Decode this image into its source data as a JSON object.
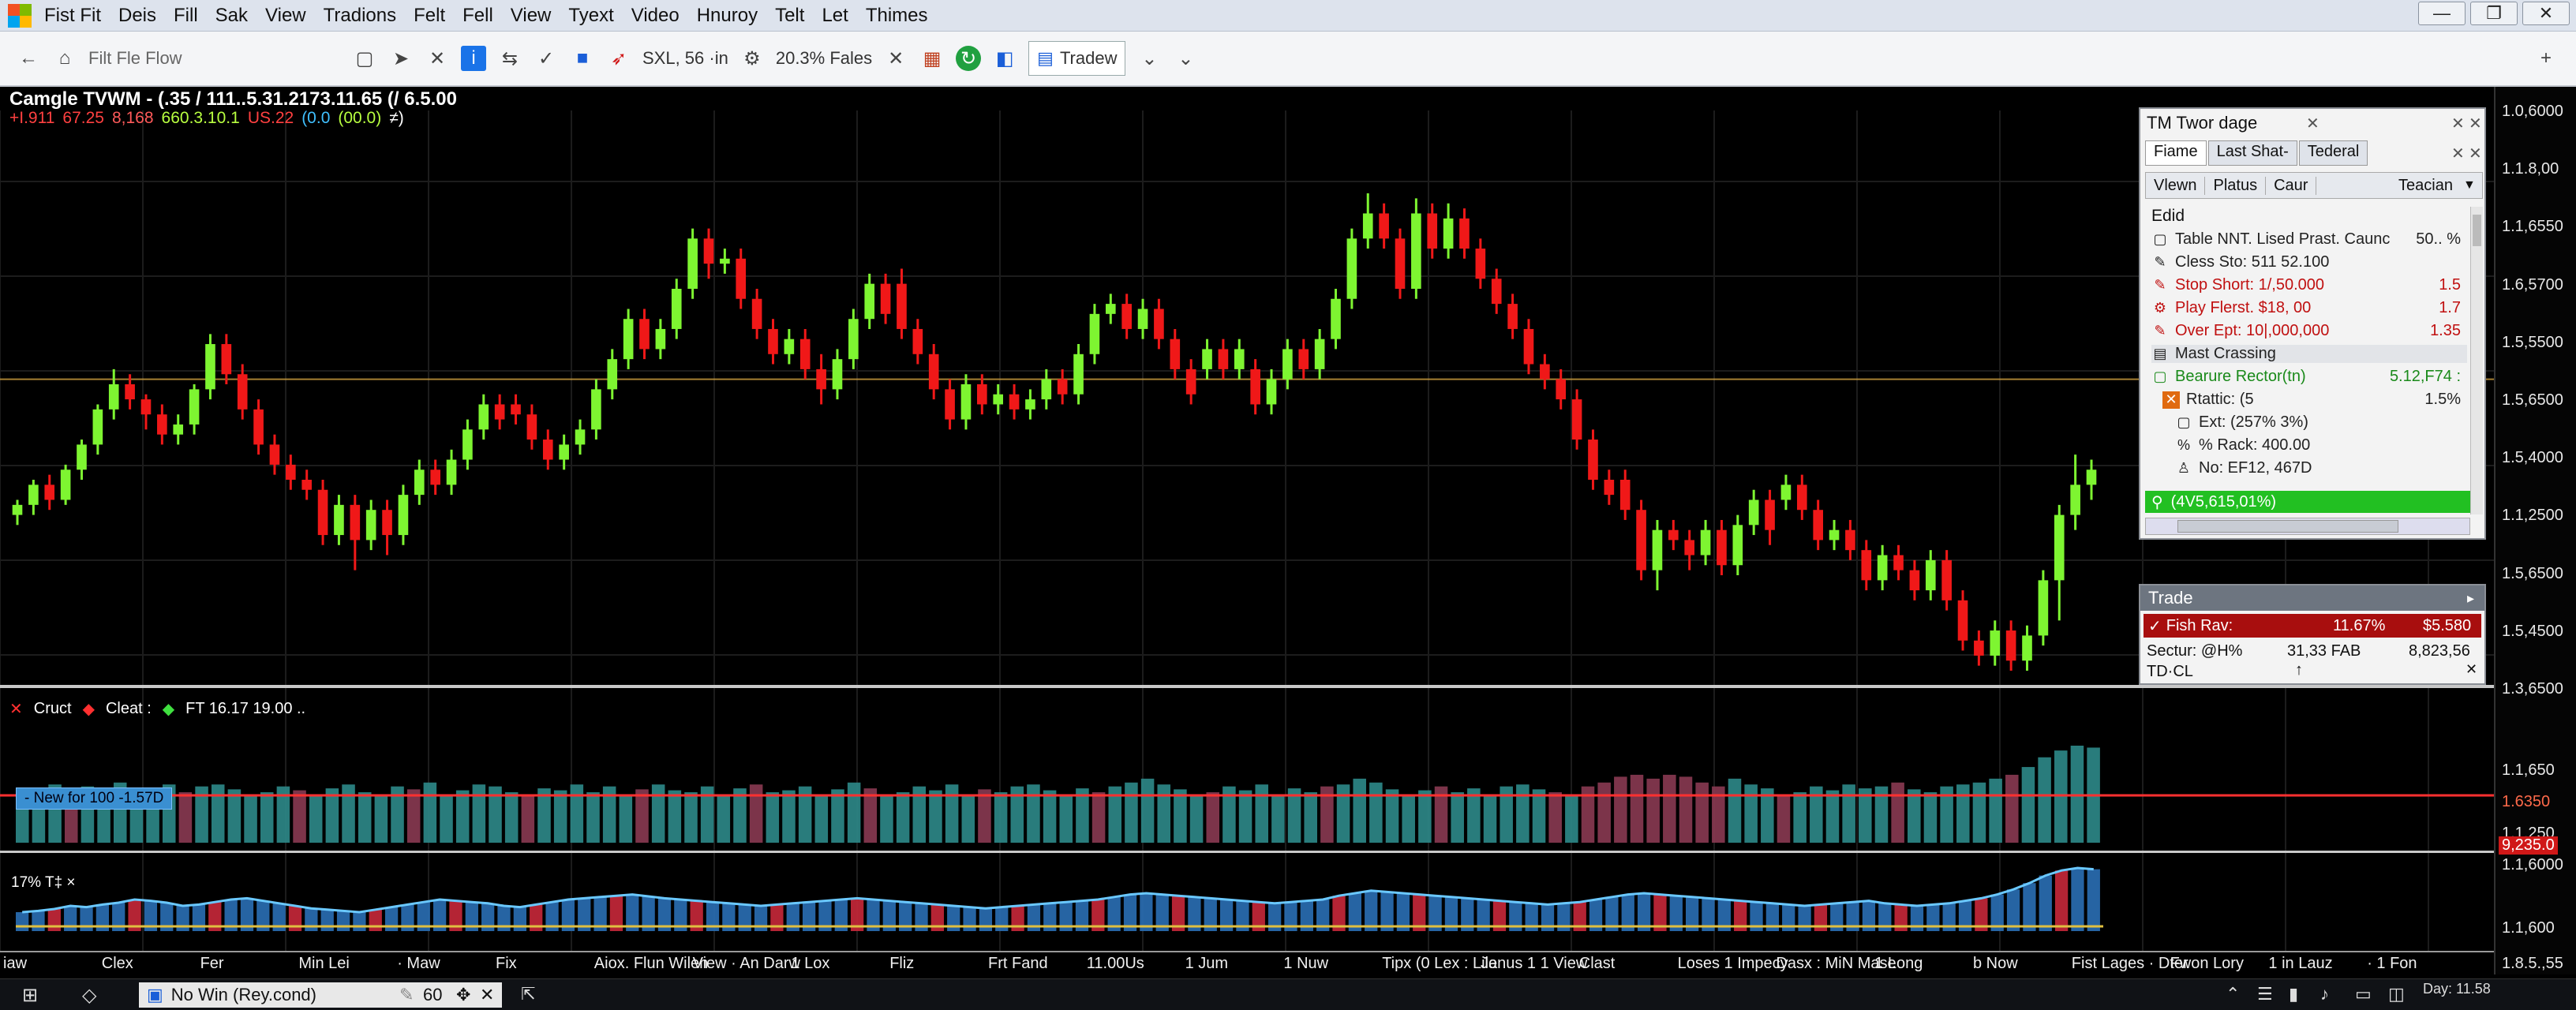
{
  "menubar": {
    "items": [
      "Fist Fit",
      "Deis",
      "Fill",
      "Sak",
      "View",
      "Tradions",
      "Felt",
      "Fell",
      "View",
      "Tyext",
      "Video",
      "Hnuroy",
      "Telt",
      "Let",
      "Thimes"
    ]
  },
  "toolbar": {
    "address": "Filt  Fle  Flow",
    "symbol_label": "SXL, 56 ·in",
    "percent_label": "20.3% Fales",
    "tradew_label": "Tradew"
  },
  "main_legend": {
    "title": "Camgle TVWM - (.35 / 111..5.31.2173.11.65 (/ 6.5.00",
    "values": [
      {
        "text": "+I.911",
        "color": "#ff4040"
      },
      {
        "text": "67.25",
        "color": "#ff4040"
      },
      {
        "text": "8,168",
        "color": "#ff5a5a"
      },
      {
        "text": "660.3.10.1",
        "color": "#b8ff40"
      },
      {
        "text": "US.22",
        "color": "#ff4040"
      },
      {
        "text": "(0.0",
        "color": "#40c0ff"
      },
      {
        "text": "(00.0)",
        "color": "#b8ff40"
      },
      {
        "text": "≠)",
        "color": "#ffffff"
      }
    ]
  },
  "price_axis": {
    "labels": [
      "1.0,6000",
      "1.1.8,00",
      "1.1,6550",
      "1.6,5700",
      "1.5,5500",
      "1.5,6500",
      "1.5,4000",
      "1.1,2500",
      "1.5,6500",
      "1.5,4500",
      "1.3,6500"
    ]
  },
  "sub_legend": {
    "item1": "Cruct",
    "item2": "Cleat :",
    "item3": "FT 16.17 19.00 .."
  },
  "volume": {
    "tag": "- New for 100 -1.57D",
    "axis_labels": [
      "1.1,650",
      "1.6350",
      "1.1,250"
    ],
    "highlight_label": "9,235.0"
  },
  "oscillator": {
    "tag": "17% T‡ ×",
    "axis_labels": [
      "1.1,6000",
      "1.1,600",
      "1.8.5.,55"
    ]
  },
  "time_axis": {
    "labels": [
      "iaw",
      "Clex",
      "Fer",
      "Min Lei",
      "· Maw",
      "Fix",
      "Aiox. Flun Wilen",
      "View · An Darw",
      "1 Lox",
      "Fliz",
      "Frt Fand",
      "11.00Us",
      "1 Jum",
      "1 Nuw",
      "Tipx (0 Lex : Lile",
      "Janus 1 1 View",
      "Clast",
      "Loses 1 Impecy",
      "Dasx : MiN Mase",
      "1 Long",
      "b Now",
      "Fist Lages · Dter",
      "Fwon Lory",
      "1 in Lauz",
      "· 1 Fon"
    ]
  },
  "panel": {
    "title": "TM Twor dage",
    "tabs": [
      "Fiame",
      "Last  Shat-",
      "Tederal"
    ],
    "subtabs": [
      "Vlewn",
      "Platus",
      "Caur"
    ],
    "subtab_right": "Teacian",
    "section": "Edid",
    "rows": [
      {
        "label": "Table NNT. Lised Prast. Caunc",
        "value": "50.. %",
        "color": "#222"
      },
      {
        "label": "Cless Sto: 511 52.100",
        "value": "",
        "color": "#222"
      },
      {
        "label": "Stop Short: 1/,50.000",
        "value": "1.5",
        "color": "#c01010"
      },
      {
        "label": "Play Flerst. $18, 00",
        "value": "1.7",
        "color": "#c01010"
      },
      {
        "label": "Over Ept: 10|,000,000",
        "value": "1.35",
        "color": "#c01010"
      },
      {
        "label": "Mast Crassing",
        "value": "",
        "color": "#222"
      },
      {
        "label": "Bearure Rector(tn)",
        "value": "5.12,F74 :",
        "color": "#1a8a1a"
      },
      {
        "label": "Rtattic: (5",
        "value": "1.5%",
        "color": "#222"
      },
      {
        "label": "Ext: (257% 3%)",
        "value": "",
        "color": "#222"
      },
      {
        "label": "% Rack: 400.00",
        "value": "",
        "color": "#222"
      },
      {
        "label": "No: EF12, 467D",
        "value": "",
        "color": "#222"
      }
    ],
    "highlight_row": "(4V5,615,01%)"
  },
  "trade": {
    "title": "Trade",
    "row1_label": "Fish Rav:",
    "row1_pct": "11.67%",
    "row1_val": "$5.580",
    "row2_label": "Sectur: @H%",
    "row2_mid": "31,33 FAB",
    "row2_val": "8,823,56",
    "row3_label": "TD·CL"
  },
  "taskbar": {
    "window_label": "No Win (Rey.cond)",
    "count": "60",
    "clock": "Day: 11.58"
  },
  "colors": {
    "bull": "#7ef531",
    "bear": "#f01818",
    "hline": "#d0a040",
    "volume_line": "#ff3030"
  },
  "chart_data": {
    "type": "candlestick",
    "candles": [
      [
        1.33,
        1.35,
        1.36,
        1.31
      ],
      [
        1.35,
        1.39,
        1.4,
        1.33
      ],
      [
        1.39,
        1.36,
        1.41,
        1.34
      ],
      [
        1.36,
        1.42,
        1.43,
        1.35
      ],
      [
        1.42,
        1.47,
        1.48,
        1.4
      ],
      [
        1.47,
        1.54,
        1.55,
        1.45
      ],
      [
        1.54,
        1.59,
        1.62,
        1.52
      ],
      [
        1.59,
        1.56,
        1.61,
        1.54
      ],
      [
        1.56,
        1.53,
        1.57,
        1.5
      ],
      [
        1.53,
        1.49,
        1.55,
        1.47
      ],
      [
        1.49,
        1.51,
        1.53,
        1.47
      ],
      [
        1.51,
        1.58,
        1.59,
        1.49
      ],
      [
        1.58,
        1.67,
        1.69,
        1.56
      ],
      [
        1.67,
        1.61,
        1.69,
        1.59
      ],
      [
        1.61,
        1.54,
        1.63,
        1.52
      ],
      [
        1.54,
        1.47,
        1.56,
        1.45
      ],
      [
        1.47,
        1.43,
        1.49,
        1.41
      ],
      [
        1.43,
        1.4,
        1.45,
        1.38
      ],
      [
        1.4,
        1.38,
        1.42,
        1.36
      ],
      [
        1.38,
        1.29,
        1.4,
        1.27
      ],
      [
        1.29,
        1.35,
        1.37,
        1.27
      ],
      [
        1.35,
        1.28,
        1.37,
        1.22
      ],
      [
        1.28,
        1.34,
        1.36,
        1.26
      ],
      [
        1.34,
        1.29,
        1.36,
        1.25
      ],
      [
        1.29,
        1.37,
        1.39,
        1.27
      ],
      [
        1.37,
        1.42,
        1.44,
        1.35
      ],
      [
        1.42,
        1.39,
        1.44,
        1.37
      ],
      [
        1.39,
        1.44,
        1.46,
        1.37
      ],
      [
        1.44,
        1.5,
        1.52,
        1.42
      ],
      [
        1.5,
        1.55,
        1.57,
        1.48
      ],
      [
        1.55,
        1.52,
        1.57,
        1.5
      ],
      [
        1.55,
        1.53,
        1.57,
        1.51
      ],
      [
        1.53,
        1.48,
        1.55,
        1.46
      ],
      [
        1.48,
        1.44,
        1.5,
        1.42
      ],
      [
        1.44,
        1.47,
        1.49,
        1.42
      ],
      [
        1.47,
        1.5,
        1.52,
        1.45
      ],
      [
        1.5,
        1.58,
        1.6,
        1.48
      ],
      [
        1.58,
        1.64,
        1.66,
        1.56
      ],
      [
        1.64,
        1.72,
        1.74,
        1.62
      ],
      [
        1.72,
        1.66,
        1.74,
        1.64
      ],
      [
        1.66,
        1.7,
        1.72,
        1.64
      ],
      [
        1.7,
        1.78,
        1.8,
        1.68
      ],
      [
        1.78,
        1.88,
        1.9,
        1.76
      ],
      [
        1.88,
        1.83,
        1.9,
        1.8
      ],
      [
        1.83,
        1.84,
        1.86,
        1.81
      ],
      [
        1.84,
        1.76,
        1.86,
        1.74
      ],
      [
        1.76,
        1.7,
        1.78,
        1.68
      ],
      [
        1.7,
        1.65,
        1.72,
        1.63
      ],
      [
        1.65,
        1.68,
        1.7,
        1.63
      ],
      [
        1.68,
        1.62,
        1.7,
        1.6
      ],
      [
        1.62,
        1.58,
        1.65,
        1.55
      ],
      [
        1.58,
        1.64,
        1.66,
        1.56
      ],
      [
        1.64,
        1.72,
        1.74,
        1.62
      ],
      [
        1.72,
        1.79,
        1.81,
        1.7
      ],
      [
        1.79,
        1.73,
        1.81,
        1.71
      ],
      [
        1.79,
        1.7,
        1.82,
        1.68
      ],
      [
        1.7,
        1.65,
        1.72,
        1.63
      ],
      [
        1.65,
        1.58,
        1.67,
        1.56
      ],
      [
        1.58,
        1.52,
        1.6,
        1.5
      ],
      [
        1.52,
        1.59,
        1.61,
        1.5
      ],
      [
        1.59,
        1.55,
        1.61,
        1.53
      ],
      [
        1.55,
        1.57,
        1.59,
        1.53
      ],
      [
        1.57,
        1.54,
        1.59,
        1.52
      ],
      [
        1.54,
        1.56,
        1.58,
        1.52
      ],
      [
        1.56,
        1.6,
        1.62,
        1.54
      ],
      [
        1.6,
        1.57,
        1.62,
        1.55
      ],
      [
        1.57,
        1.65,
        1.67,
        1.55
      ],
      [
        1.65,
        1.73,
        1.75,
        1.63
      ],
      [
        1.73,
        1.75,
        1.77,
        1.71
      ],
      [
        1.75,
        1.7,
        1.77,
        1.68
      ],
      [
        1.7,
        1.74,
        1.76,
        1.68
      ],
      [
        1.74,
        1.68,
        1.76,
        1.66
      ],
      [
        1.68,
        1.62,
        1.7,
        1.6
      ],
      [
        1.62,
        1.57,
        1.64,
        1.55
      ],
      [
        1.62,
        1.66,
        1.68,
        1.6
      ],
      [
        1.66,
        1.62,
        1.68,
        1.6
      ],
      [
        1.62,
        1.66,
        1.68,
        1.6
      ],
      [
        1.62,
        1.55,
        1.64,
        1.53
      ],
      [
        1.55,
        1.6,
        1.62,
        1.53
      ],
      [
        1.6,
        1.66,
        1.68,
        1.58
      ],
      [
        1.66,
        1.62,
        1.68,
        1.6
      ],
      [
        1.62,
        1.68,
        1.7,
        1.6
      ],
      [
        1.68,
        1.76,
        1.78,
        1.66
      ],
      [
        1.76,
        1.88,
        1.9,
        1.74
      ],
      [
        1.88,
        1.93,
        1.97,
        1.86
      ],
      [
        1.93,
        1.88,
        1.95,
        1.86
      ],
      [
        1.88,
        1.78,
        1.9,
        1.76
      ],
      [
        1.78,
        1.93,
        1.96,
        1.76
      ],
      [
        1.93,
        1.86,
        1.95,
        1.84
      ],
      [
        1.86,
        1.92,
        1.95,
        1.84
      ],
      [
        1.92,
        1.86,
        1.94,
        1.84
      ],
      [
        1.86,
        1.8,
        1.88,
        1.78
      ],
      [
        1.8,
        1.75,
        1.82,
        1.73
      ],
      [
        1.75,
        1.7,
        1.77,
        1.68
      ],
      [
        1.7,
        1.63,
        1.72,
        1.61
      ],
      [
        1.63,
        1.6,
        1.65,
        1.58
      ],
      [
        1.6,
        1.56,
        1.62,
        1.54
      ],
      [
        1.56,
        1.48,
        1.58,
        1.46
      ],
      [
        1.48,
        1.4,
        1.5,
        1.38
      ],
      [
        1.4,
        1.37,
        1.42,
        1.35
      ],
      [
        1.4,
        1.34,
        1.42,
        1.32
      ],
      [
        1.34,
        1.22,
        1.36,
        1.2
      ],
      [
        1.22,
        1.3,
        1.32,
        1.18
      ],
      [
        1.3,
        1.28,
        1.32,
        1.26
      ],
      [
        1.28,
        1.25,
        1.3,
        1.22
      ],
      [
        1.25,
        1.3,
        1.32,
        1.23
      ],
      [
        1.3,
        1.23,
        1.32,
        1.21
      ],
      [
        1.23,
        1.31,
        1.33,
        1.21
      ],
      [
        1.31,
        1.36,
        1.38,
        1.29
      ],
      [
        1.36,
        1.3,
        1.38,
        1.27
      ],
      [
        1.36,
        1.39,
        1.41,
        1.34
      ],
      [
        1.39,
        1.34,
        1.41,
        1.32
      ],
      [
        1.34,
        1.28,
        1.36,
        1.26
      ],
      [
        1.28,
        1.3,
        1.32,
        1.26
      ],
      [
        1.3,
        1.26,
        1.32,
        1.24
      ],
      [
        1.26,
        1.2,
        1.28,
        1.18
      ],
      [
        1.2,
        1.25,
        1.27,
        1.18
      ],
      [
        1.25,
        1.22,
        1.27,
        1.2
      ],
      [
        1.22,
        1.18,
        1.24,
        1.16
      ],
      [
        1.18,
        1.24,
        1.26,
        1.16
      ],
      [
        1.24,
        1.16,
        1.26,
        1.14
      ],
      [
        1.16,
        1.08,
        1.18,
        1.06
      ],
      [
        1.08,
        1.05,
        1.1,
        1.03
      ],
      [
        1.05,
        1.1,
        1.12,
        1.03
      ],
      [
        1.1,
        1.04,
        1.12,
        1.02
      ],
      [
        1.04,
        1.09,
        1.11,
        1.02
      ],
      [
        1.09,
        1.2,
        1.22,
        1.07
      ],
      [
        1.2,
        1.33,
        1.35,
        1.12
      ],
      [
        1.33,
        1.39,
        1.45,
        1.3
      ],
      [
        1.39,
        1.42,
        1.44,
        1.36
      ]
    ],
    "hline": 1.6,
    "volume": [
      0.55,
      0.5,
      0.6,
      0.52,
      0.58,
      0.54,
      0.62,
      0.5,
      0.56,
      0.6,
      0.52,
      0.58,
      0.6,
      0.55,
      0.5,
      0.52,
      0.58,
      0.54,
      0.5,
      0.56,
      0.6,
      0.52,
      0.5,
      0.58,
      0.55,
      0.62,
      0.5,
      0.54,
      0.6,
      0.58,
      0.52,
      0.5,
      0.56,
      0.54,
      0.6,
      0.52,
      0.58,
      0.5,
      0.55,
      0.6,
      0.54,
      0.52,
      0.58,
      0.5,
      0.56,
      0.6,
      0.52,
      0.54,
      0.58,
      0.5,
      0.55,
      0.62,
      0.56,
      0.5,
      0.52,
      0.58,
      0.54,
      0.6,
      0.5,
      0.55,
      0.52,
      0.58,
      0.6,
      0.54,
      0.5,
      0.56,
      0.52,
      0.58,
      0.62,
      0.66,
      0.6,
      0.55,
      0.5,
      0.52,
      0.58,
      0.54,
      0.6,
      0.5,
      0.56,
      0.52,
      0.58,
      0.6,
      0.66,
      0.62,
      0.55,
      0.5,
      0.54,
      0.58,
      0.52,
      0.56,
      0.5,
      0.58,
      0.6,
      0.55,
      0.52,
      0.5,
      0.58,
      0.62,
      0.68,
      0.7,
      0.66,
      0.7,
      0.68,
      0.62,
      0.58,
      0.66,
      0.6,
      0.56,
      0.5,
      0.52,
      0.58,
      0.54,
      0.6,
      0.56,
      0.58,
      0.62,
      0.55,
      0.52,
      0.58,
      0.6,
      0.62,
      0.66,
      0.7,
      0.78,
      0.88,
      0.95,
      1.0,
      0.98
    ],
    "oscillator": [
      0.3,
      0.32,
      0.35,
      0.4,
      0.38,
      0.42,
      0.45,
      0.5,
      0.48,
      0.45,
      0.4,
      0.42,
      0.46,
      0.5,
      0.52,
      0.48,
      0.44,
      0.4,
      0.36,
      0.34,
      0.32,
      0.3,
      0.34,
      0.38,
      0.42,
      0.46,
      0.5,
      0.48,
      0.46,
      0.44,
      0.4,
      0.38,
      0.42,
      0.46,
      0.5,
      0.52,
      0.54,
      0.56,
      0.58,
      0.55,
      0.52,
      0.5,
      0.48,
      0.46,
      0.44,
      0.42,
      0.4,
      0.42,
      0.44,
      0.46,
      0.48,
      0.5,
      0.52,
      0.5,
      0.48,
      0.46,
      0.44,
      0.42,
      0.4,
      0.38,
      0.36,
      0.38,
      0.4,
      0.42,
      0.44,
      0.46,
      0.48,
      0.5,
      0.54,
      0.58,
      0.6,
      0.58,
      0.56,
      0.54,
      0.52,
      0.5,
      0.48,
      0.46,
      0.44,
      0.46,
      0.48,
      0.5,
      0.56,
      0.6,
      0.64,
      0.62,
      0.6,
      0.58,
      0.56,
      0.54,
      0.52,
      0.5,
      0.48,
      0.46,
      0.44,
      0.42,
      0.44,
      0.46,
      0.5,
      0.54,
      0.58,
      0.6,
      0.58,
      0.56,
      0.54,
      0.52,
      0.5,
      0.48,
      0.46,
      0.44,
      0.42,
      0.4,
      0.42,
      0.44,
      0.46,
      0.48,
      0.44,
      0.42,
      0.4,
      0.42,
      0.44,
      0.48,
      0.52,
      0.58,
      0.66,
      0.76,
      0.88,
      0.96,
      1.0,
      0.98
    ]
  }
}
